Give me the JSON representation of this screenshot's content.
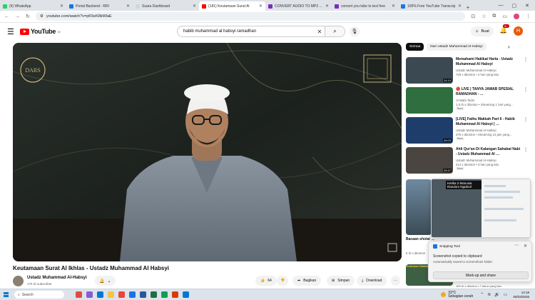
{
  "browser": {
    "tabs": [
      {
        "title": "(9) WhatsApp",
        "color": "#25d366",
        "active": false
      },
      {
        "title": "Portal Backend - RRI",
        "color": "#1a73e8",
        "active": false
      },
      {
        "title": "Suara Dashboard",
        "color": "#cfd8dc",
        "active": false
      },
      {
        "title": "(181) Keutamaan Surat Al",
        "color": "#ff0000",
        "active": true
      },
      {
        "title": "CONVERT AUDIO TO MP3 - Yo",
        "color": "#7b2cbf",
        "active": false
      },
      {
        "title": "convert you tobe to text free",
        "color": "#7b2cbf",
        "active": false
      },
      {
        "title": "100% Free YouTube Transcrip",
        "color": "#1a73e8",
        "active": false
      }
    ],
    "url": "youtube.com/watch?v=pK5eK8kWlaE"
  },
  "youtube": {
    "logo_text": "YouTube",
    "logo_region": "ID",
    "search_query": "habib muhammad al habsyi ramadhan",
    "create_label": "Buat",
    "notifications_count": "9+",
    "avatar_letter": "H"
  },
  "video": {
    "title": "Keutamaan Surat Al Ikhlas - Ustadz Muhammad Al Habsyi",
    "overlay_logo": "DARS",
    "channel_name": "Ustadz Muhammad Al-Habsyi",
    "subscribers": "175 rb subscriber",
    "like_count": "64",
    "share_label": "Bagikan",
    "save_label": "Simpan",
    "download_label": "Download"
  },
  "sidebar": {
    "chips": [
      "Semua",
      "Dari Ustadz Muhammad Al-Habsyi"
    ],
    "recommendations": [
      {
        "title": "Memahami Hakikat Harta - Ustadz Muhammad Al Habsyi",
        "channel": "Ustadz Muhammad Al-Habsyi",
        "meta": "729 x ditonton • 4 hari yang lalu",
        "duration": "24:10",
        "badge": "",
        "thumb_color": "#3b4a52"
      },
      {
        "title": "🔴 LIVE | TANYA JAWAB SPESIAL RAMADHAN - …",
        "channel": "Al Wafa Tarim",
        "meta": "1,5 rb x ditonton • Streaming 1 hari yang…",
        "duration": "",
        "badge": "Baru",
        "thumb_color": "#2f6e3f"
      },
      {
        "title": "[LIVE] Fathu Makkah Part 6 - Habib Muhammad Al Habsyi | …",
        "channel": "Ustadz Muhammad Al-Habsyi",
        "meta": "379 x ditonton • Streaming 13 jam yang…",
        "duration": "40:03",
        "badge": "Baru",
        "thumb_color": "#1f3d6b"
      },
      {
        "title": "Ahli Qur'an Di Kalangan Sahabat Nabi - Ustadz Muhammad Al …",
        "channel": "Ustadz Muhammad Al-Habsyi",
        "meta": "414 x ditonton • 3 hari yang lalu",
        "duration": "25:47",
        "badge": "Baru",
        "thumb_color": "#4a4540"
      }
    ],
    "partial_title": "Bacaan sholat …",
    "partial_meta": "6 rb x ditonton",
    "popup_caption": "Ketika 2 Manusia Random Ngobrol",
    "fifth_meta": "189 rb x ditonton • 7 tahun yang lalu",
    "fifth_thumb_text": "Tuntunan Shalat"
  },
  "snipping_toast": {
    "app_name": "Snipping Tool",
    "headline": "Screenshot copied to clipboard",
    "detail": "Automatically saved to screenshots folder.",
    "button": "Mark-up and share"
  },
  "taskbar": {
    "search_placeholder": "Search",
    "weather_temp": "33°C",
    "weather_desc": "Sebagian cerah",
    "time": "14:18",
    "date": "05/03/2026",
    "app_colors": [
      "#e04c44",
      "#8a5cd1",
      "#0078d4",
      "#f6c343",
      "#e8453c",
      "#1a73e8",
      "#2b579a",
      "#1d6f42",
      "#0f9d58",
      "#d83b01",
      "#0078d4"
    ]
  }
}
